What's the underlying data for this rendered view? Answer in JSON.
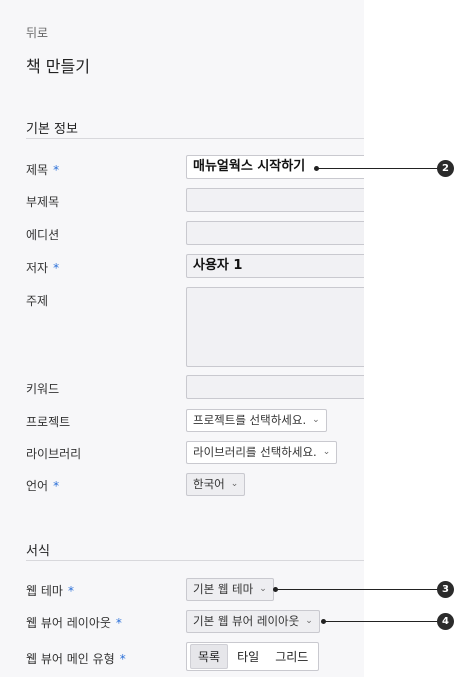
{
  "nav": {
    "back": "뒤로"
  },
  "page": {
    "title": "책 만들기"
  },
  "sections": {
    "basic": "기본 정보",
    "format": "서식"
  },
  "required_mark": "*",
  "fields": {
    "title": {
      "label": "제목",
      "value": "매뉴얼웍스 시작하기"
    },
    "subtitle": {
      "label": "부제목",
      "value": ""
    },
    "edition": {
      "label": "에디션",
      "value": ""
    },
    "author": {
      "label": "저자",
      "value": "사용자 1"
    },
    "subject": {
      "label": "주제",
      "value": ""
    },
    "keyword": {
      "label": "키워드",
      "value": ""
    },
    "project": {
      "label": "프로젝트",
      "placeholder": "프로젝트를 선택하세요."
    },
    "library": {
      "label": "라이브러리",
      "placeholder": "라이브러리를 선택하세요."
    },
    "language": {
      "label": "언어",
      "value": "한국어"
    }
  },
  "format": {
    "web_theme": {
      "label": "웹 테마",
      "value": "기본 웹 테마"
    },
    "viewer_layout": {
      "label": "웹 뷰어 레이아웃",
      "value": "기본 웹 뷰어 레이아웃"
    },
    "viewer_main_type": {
      "label": "웹 뷰어 메인 유형",
      "options": [
        "목록",
        "타일",
        "그리드"
      ],
      "selected": "목록"
    }
  },
  "callouts": [
    "2",
    "3",
    "4"
  ],
  "icons": {
    "dropdown": "chevron-down-icon"
  }
}
